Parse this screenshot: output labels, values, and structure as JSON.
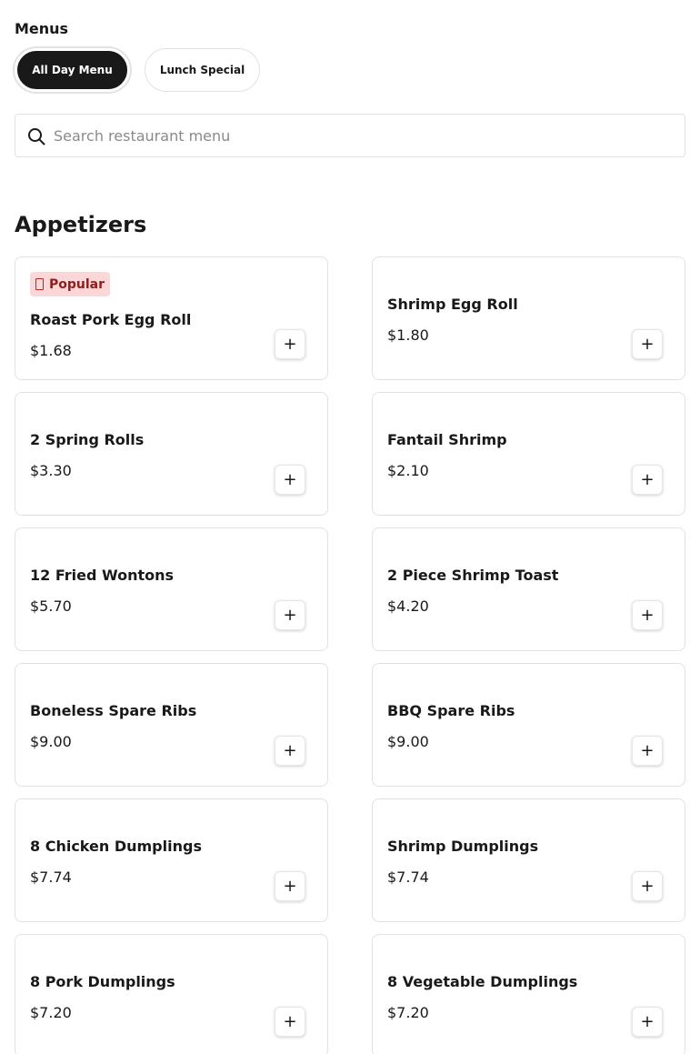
{
  "menus": {
    "title": "Menus",
    "tabs": [
      {
        "label": "All Day Menu",
        "active": true
      },
      {
        "label": "Lunch Special",
        "active": false
      }
    ]
  },
  "search": {
    "placeholder": "Search restaurant menu",
    "value": "",
    "icon": "search-icon"
  },
  "section": {
    "title": "Appetizers",
    "items": [
      {
        "name": "Roast Pork Egg Roll",
        "price": "$1.68",
        "badge": "Popular"
      },
      {
        "name": "Shrimp Egg Roll",
        "price": "$1.80"
      },
      {
        "name": "2 Spring Rolls",
        "price": "$3.30"
      },
      {
        "name": "Fantail Shrimp",
        "price": "$2.10"
      },
      {
        "name": "12 Fried Wontons",
        "price": "$5.70"
      },
      {
        "name": "2 Piece Shrimp Toast",
        "price": "$4.20"
      },
      {
        "name": "Boneless Spare Ribs",
        "price": "$9.00"
      },
      {
        "name": "BBQ Spare Ribs",
        "price": "$9.00"
      },
      {
        "name": "8 Chicken Dumplings",
        "price": "$7.74"
      },
      {
        "name": "Shrimp Dumplings",
        "price": "$7.74"
      },
      {
        "name": "8 Pork Dumplings",
        "price": "$7.20"
      },
      {
        "name": "8 Vegetable Dumplings",
        "price": "$7.20"
      }
    ],
    "add_label": "+"
  },
  "colors": {
    "active_pill": "#191919",
    "badge_bg": "#fbd7d7",
    "badge_text": "#8f1d1d",
    "border": "#e2e2e2"
  }
}
